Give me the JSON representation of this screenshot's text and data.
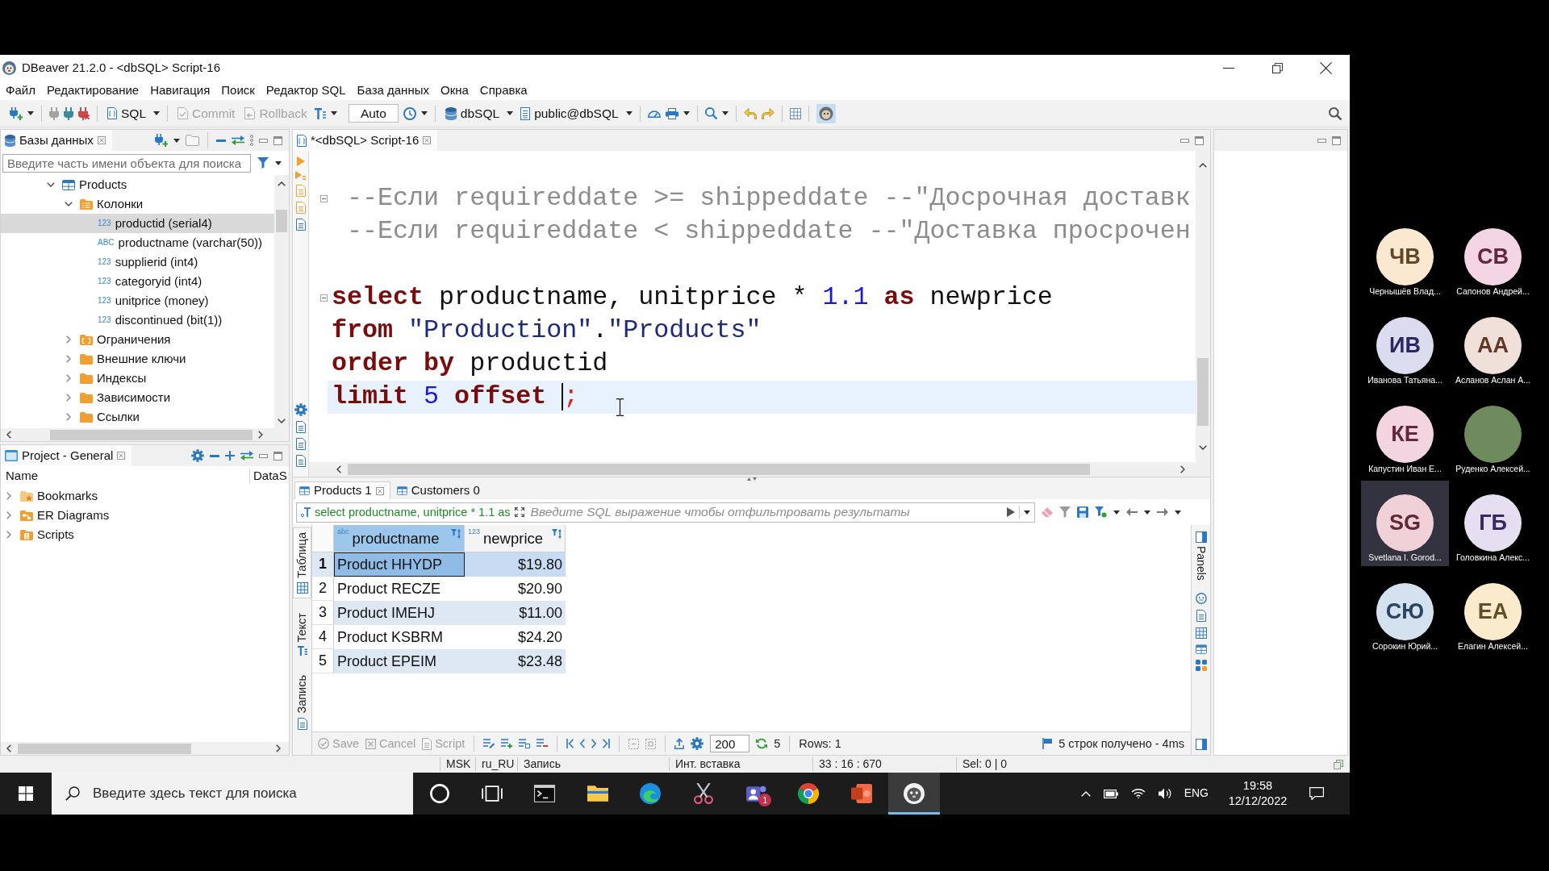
{
  "window": {
    "title": "DBeaver 21.2.0 - <dbSQL> Script-16"
  },
  "menu": [
    "Файл",
    "Редактирование",
    "Навигация",
    "Поиск",
    "Редактор SQL",
    "База данных",
    "Окна",
    "Справка"
  ],
  "toolbar": {
    "sql": "SQL",
    "commit": {
      "label": "Commit",
      "disabled": true
    },
    "rollback": {
      "label": "Rollback",
      "disabled": true
    },
    "commit_mode": "Auto",
    "datasource": "dbSQL",
    "schema": "public@dbSQL"
  },
  "navigator": {
    "tab": "Базы данных",
    "search": {
      "placeholder": "Введите часть имени объекта для поиска"
    },
    "tree": [
      {
        "label": "Products",
        "kind": "table",
        "expanded": true,
        "selected": false,
        "children": [
          {
            "label": "Колонки",
            "kind": "columns",
            "expanded": true,
            "selected": false,
            "children": [
              {
                "label": "productid (serial4)",
                "kind": "column",
                "type_label": "123",
                "selected": true
              },
              {
                "label": "productname (varchar(50))",
                "kind": "column",
                "type_label": "ABC",
                "selected": false
              },
              {
                "label": "supplierid (int4)",
                "kind": "column",
                "type_label": "123",
                "selected": false
              },
              {
                "label": "categoryid (int4)",
                "kind": "column",
                "type_label": "123",
                "selected": false
              },
              {
                "label": "unitprice (money)",
                "kind": "column",
                "type_label": "123",
                "selected": false
              },
              {
                "label": "discontinued (bit(1))",
                "kind": "column",
                "type_label": "123",
                "selected": false
              }
            ]
          },
          {
            "label": "Ограничения",
            "kind": "constraints",
            "expanded": false,
            "selected": false
          },
          {
            "label": "Внешние ключи",
            "kind": "folder",
            "expanded": false,
            "selected": false
          },
          {
            "label": "Индексы",
            "kind": "folder",
            "expanded": false,
            "selected": false
          },
          {
            "label": "Зависимости",
            "kind": "folder",
            "expanded": false,
            "selected": false
          },
          {
            "label": "Ссылки",
            "kind": "folder",
            "expanded": false,
            "selected": false
          }
        ]
      }
    ]
  },
  "project": {
    "tab": "Project - General",
    "columns": [
      "Name",
      "DataS"
    ],
    "items": [
      {
        "label": "Bookmarks",
        "kind": "bookmarks",
        "expanded": false,
        "selected": false
      },
      {
        "label": "ER Diagrams",
        "kind": "diagrams",
        "expanded": false,
        "selected": false
      },
      {
        "label": "Scripts",
        "kind": "scripts",
        "expanded": false,
        "selected": false
      }
    ]
  },
  "editor": {
    "tab": "*<dbSQL> Script-16",
    "blocks": [
      {
        "collapsed": false,
        "lines": [
          {
            "current": false,
            "tokens": [
              {
                "kind": "comment",
                "text": " --Если requireddate >= shippeddate --\"Досрочная доставк"
              }
            ]
          },
          {
            "current": false,
            "tokens": [
              {
                "kind": "comment",
                "text": " --Если requireddate < shippeddate --\"Доставка просрочен"
              }
            ]
          }
        ]
      },
      {
        "collapsed": false,
        "lines": [
          {
            "current": false,
            "tokens": [
              {
                "kind": "keyword",
                "text": "select"
              },
              {
                "kind": "plain",
                "text": " productname, unitprice * "
              },
              {
                "kind": "number",
                "text": "1.1"
              },
              {
                "kind": "keyword",
                "text": " as"
              },
              {
                "kind": "plain",
                "text": " newprice"
              }
            ]
          },
          {
            "current": false,
            "tokens": [
              {
                "kind": "keyword",
                "text": "from"
              },
              {
                "kind": "string",
                "text": " \"Production\""
              },
              {
                "kind": "plain",
                "text": "."
              },
              {
                "kind": "string",
                "text": "\"Products\""
              }
            ]
          },
          {
            "current": false,
            "tokens": [
              {
                "kind": "keyword",
                "text": "order by"
              },
              {
                "kind": "plain",
                "text": " productid"
              }
            ]
          },
          {
            "current": true,
            "tokens": [
              {
                "kind": "keyword",
                "text": "limit"
              },
              {
                "kind": "number",
                "text": " 5"
              },
              {
                "kind": "keyword",
                "text": " offset "
              },
              {
                "kind": "caret"
              },
              {
                "kind": "delimiter",
                "text": ";"
              }
            ]
          }
        ]
      }
    ]
  },
  "results": {
    "tabs": [
      {
        "label": "Products 1",
        "selected": true
      },
      {
        "label": "Customers 0",
        "selected": false
      }
    ],
    "query": "select productname, unitprice * 1.1 as",
    "filter": {
      "placeholder": "Введите SQL выражение чтобы отфильтровать результаты"
    },
    "views": [
      {
        "label": "Таблица",
        "kind": "table",
        "selected": true
      },
      {
        "label": "Текст",
        "kind": "text",
        "selected": false
      },
      {
        "label": "Запись",
        "kind": "record",
        "selected": false
      }
    ],
    "columns": [
      {
        "label": "productname",
        "type_label": "abc",
        "kind": "text",
        "selected": true
      },
      {
        "label": "newprice",
        "type_label": "123",
        "kind": "numeric",
        "selected": false
      }
    ],
    "rows": [
      {
        "number": "1",
        "selected": true,
        "cells": [
          "Product HHYDP",
          "$19.80"
        ]
      },
      {
        "number": "2",
        "selected": false,
        "cells": [
          "Product RECZE",
          "$20.90"
        ]
      },
      {
        "number": "3",
        "selected": false,
        "cells": [
          "Product IMEHJ",
          "$11.00"
        ]
      },
      {
        "number": "4",
        "selected": false,
        "cells": [
          "Product KSBRM",
          "$24.20"
        ]
      },
      {
        "number": "5",
        "selected": false,
        "cells": [
          "Product EPEIM",
          "$23.48"
        ]
      }
    ],
    "panels": "Panels",
    "actions": [
      {
        "label": "Save",
        "kind": "save",
        "disabled": true
      },
      {
        "label": "Cancel",
        "kind": "cancel",
        "disabled": true
      },
      {
        "label": "Script",
        "kind": "script",
        "disabled": true
      }
    ],
    "fetch_size": "200",
    "fetched_count": "5",
    "rows_label": "Rows: 1",
    "fetch_status": "5 строк получено - 4ms"
  },
  "status_bar": [
    "MSK",
    "ru_RU",
    "Запись",
    "Инт. вставка",
    "33 : 16 : 670",
    "Sel: 0 | 0"
  ],
  "taskbar": {
    "search": {
      "placeholder": "Введите здесь текст для поиска"
    },
    "apps": [
      {
        "kind": "ring",
        "active": false
      },
      {
        "kind": "task-view",
        "active": false
      },
      {
        "kind": "terminal",
        "active": false
      },
      {
        "kind": "folder",
        "active": false
      },
      {
        "kind": "swirl",
        "active": false
      },
      {
        "kind": "scissors",
        "active": false
      },
      {
        "kind": "people",
        "active": false,
        "badge": "1"
      },
      {
        "kind": "tricolor",
        "active": false
      },
      {
        "kind": "slides",
        "active": false
      },
      {
        "kind": "beaver",
        "active": true
      }
    ],
    "language": "ENG",
    "time": "19:58",
    "date": "12/12/2022"
  },
  "participants": [
    {
      "initials": "ЧВ",
      "name": "Чернышёв Влад...",
      "color": "#fbe8d1",
      "kind": "initials",
      "selected": false
    },
    {
      "initials": "СВ",
      "name": "Сапонов Андрей...",
      "color": "#f3d5e3",
      "kind": "initials",
      "selected": false
    },
    {
      "initials": "ИВ",
      "name": "Иванова Татьяна...",
      "color": "#dcdcf1",
      "kind": "initials",
      "selected": false
    },
    {
      "initials": "АА",
      "name": "Асланов Аслан А...",
      "color": "#f0e0da",
      "kind": "initials",
      "selected": false
    },
    {
      "initials": "КЕ",
      "name": "Капустин Иван Е...",
      "color": "#f2d5e0",
      "kind": "initials",
      "selected": false
    },
    {
      "name": "Руденко Алексей...",
      "kind": "photo",
      "selected": false
    },
    {
      "initials": "SG",
      "name": "Svetlana I. Gorod...",
      "color": "#f0d1d8",
      "kind": "initials",
      "selected": true
    },
    {
      "initials": "ГБ",
      "name": "Головкина Алекс...",
      "color": "#e5dff1",
      "kind": "initials",
      "selected": false
    },
    {
      "initials": "СЮ",
      "name": "Сорокин Юрий...",
      "color": "#d4e1ef",
      "kind": "initials",
      "selected": false
    },
    {
      "initials": "ЕА",
      "name": "Елагин Алексей...",
      "color": "#faebcc",
      "kind": "initials",
      "selected": false
    }
  ]
}
